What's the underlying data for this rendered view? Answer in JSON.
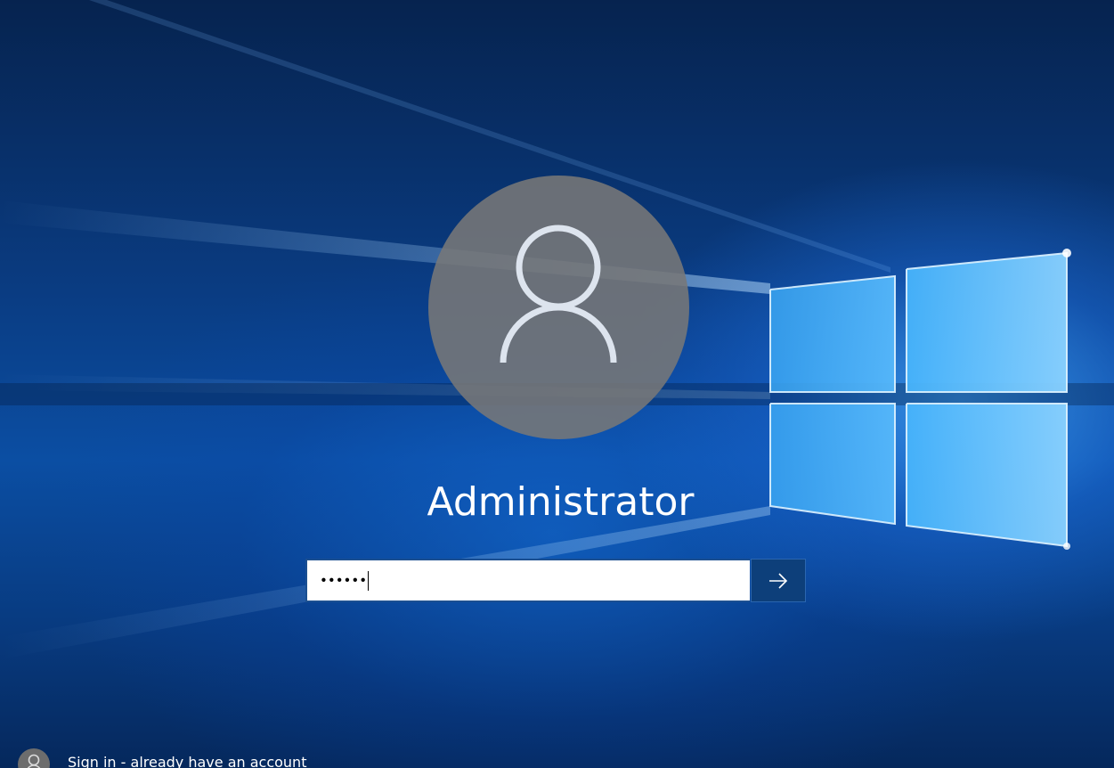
{
  "user": {
    "name": "Administrator",
    "avatar_icon": "user-silhouette-icon"
  },
  "password": {
    "masked_value": "••••••",
    "submit_icon": "arrow-right-icon"
  },
  "other_user": {
    "label": "Sign in - already have an account",
    "icon": "user-silhouette-icon"
  },
  "colors": {
    "avatar_background": "#787878",
    "submit_button": "#0d3f7a",
    "text": "#ffffff"
  }
}
